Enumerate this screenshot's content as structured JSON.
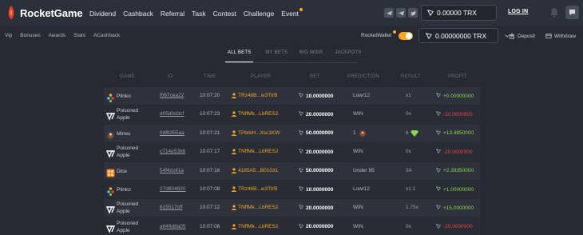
{
  "header": {
    "logo": "RocketGame",
    "nav": [
      {
        "label": "Dividend"
      },
      {
        "label": "Cashback"
      },
      {
        "label": "Referral"
      },
      {
        "label": "Task"
      },
      {
        "label": "Contest"
      },
      {
        "label": "Challenge"
      },
      {
        "label": "Event",
        "dot": true
      }
    ],
    "balance": "0.00000 TRX",
    "login": "LOG IN"
  },
  "subnav": [
    "Vip",
    "Bonuses",
    "Awards",
    "Stats",
    "ACashback"
  ],
  "wallet": {
    "label": "RocketWallet",
    "balance": "0.00000000 TRX",
    "deposit": "Deposit",
    "withdraw": "Withdraw"
  },
  "tabs": [
    "ALL BETS",
    "MY BETS",
    "BIG WINS",
    "JACKPOTS"
  ],
  "table": {
    "headers": [
      "GAME",
      "ID",
      "TIME",
      "PLAYER",
      "BET",
      "PREDICTION",
      "RESULT",
      "PROFIT"
    ],
    "rows": [
      {
        "game": "Plinko",
        "icon": "plinko-icon",
        "id": "f067cea22",
        "time": "10:07:20",
        "player": "TRz46B...w3TtrB",
        "bet": "10.0000000",
        "prediction": "Low/12",
        "result": "x1",
        "profit": "+0.00000000",
        "sign": "pos"
      },
      {
        "game": "Poisoned Apple",
        "icon": "poisoned-apple-icon",
        "id": "d05d0d3cf",
        "time": "10:07:23",
        "player": "TNffMk...LbRES2",
        "bet": "20.0000000",
        "prediction": "WIN",
        "result": "0x",
        "profit": "-20.0000000",
        "sign": "neg"
      },
      {
        "game": "Mines",
        "icon": "mines-icon",
        "id": "0df8355aa",
        "time": "10:07:21",
        "player": "TPbrkH...Xsc1KW",
        "bet": "50.0000000",
        "prediction": "1",
        "result": "6",
        "profit": "+13.4850000",
        "sign": "pos"
      },
      {
        "game": "Poisoned Apple",
        "icon": "poisoned-apple-icon",
        "id": "c714e53b6",
        "time": "10:07:17",
        "player": "TNffMk...LbRES2",
        "bet": "20.0000000",
        "prediction": "WIN",
        "result": "0x",
        "profit": "-20.0000000",
        "sign": "neg"
      },
      {
        "game": "Dice",
        "icon": "dice-icon",
        "id": "54f4cc41a",
        "time": "10:07:16",
        "player": "4185A5...B01031",
        "bet": "50.0000000",
        "prediction": "Under 95",
        "result": "34",
        "profit": "+2.39350000",
        "sign": "pos"
      },
      {
        "game": "Plinko",
        "icon": "plinko-icon",
        "id": "27d804820",
        "time": "10:07:08",
        "player": "TRz46B...w3TtrB",
        "bet": "10.0000000",
        "prediction": "Low/12",
        "result": "x1.1",
        "profit": "+1.00000000",
        "sign": "pos"
      },
      {
        "game": "Poisoned Apple",
        "icon": "poisoned-apple-icon",
        "id": "615517cff",
        "time": "10:07:12",
        "player": "TNffMk...LbRES2",
        "bet": "20.0000000",
        "prediction": "WIN",
        "result": "1.75x",
        "profit": "+15.0000000",
        "sign": "pos"
      },
      {
        "game": "Poisoned Apple",
        "icon": "poisoned-apple-icon",
        "id": "a649d8a05",
        "time": "10:07:08",
        "player": "TNffMk...LbRES2",
        "bet": "20.0000000",
        "prediction": "WIN",
        "result": "0x",
        "profit": "-20.0000000",
        "sign": "neg"
      }
    ]
  },
  "colors": {
    "accent": "#f5a623",
    "positive": "#8ad64b",
    "negative": "#ef4444",
    "brand": "#e5402b"
  }
}
